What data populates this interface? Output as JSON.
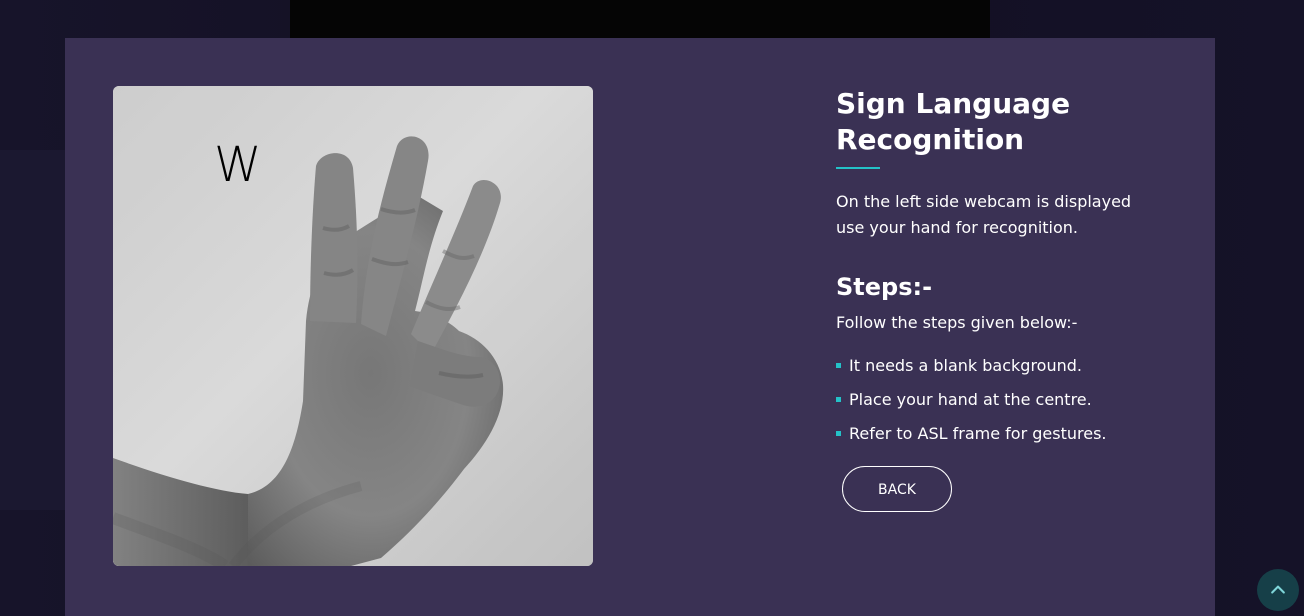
{
  "webcam": {
    "detected_letter": "W"
  },
  "content": {
    "title": "Sign Language Recognition",
    "description": "On the left side webcam is displayed use your hand for recognition.",
    "steps_title": "Steps:-",
    "steps_intro": "Follow the steps given below:-",
    "steps": [
      "It needs a blank background.",
      "Place your hand at the centre.",
      "Refer to ASL frame for gestures."
    ],
    "back_button": "BACK"
  },
  "colors": {
    "panel": "#3a3154",
    "accent": "#24c2c8",
    "page_background": "#120f22",
    "scroll_button": "#163f48"
  },
  "icons": {
    "scroll_top": "chevron-up-icon"
  }
}
